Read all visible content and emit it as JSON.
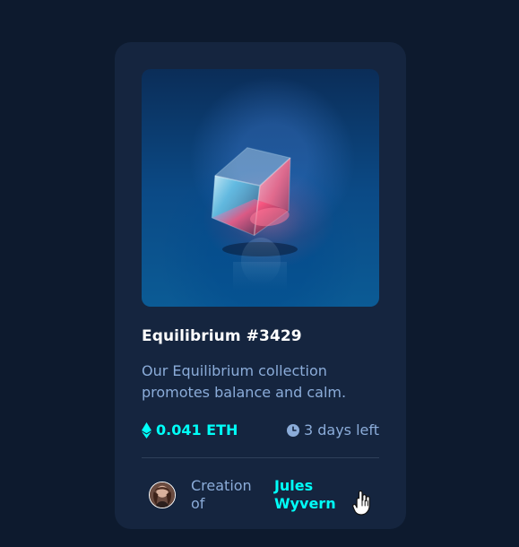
{
  "card": {
    "title": "Equilibrium #3429",
    "description": "Our Equilibrium collection promotes balance and calm.",
    "price": "0.041 ETH",
    "time_left": "3 days left",
    "creator_prefix": "Creation of",
    "creator_name": "Jules Wyvern"
  },
  "colors": {
    "page_background": "#0d1a2e",
    "card_background": "#15253f",
    "accent": "#00fff8",
    "muted_text": "#8bacd9",
    "title_text": "#ffffff"
  },
  "icons": {
    "price": "ethereum-icon",
    "time": "clock-icon",
    "cursor": "hand-pointer-icon"
  }
}
